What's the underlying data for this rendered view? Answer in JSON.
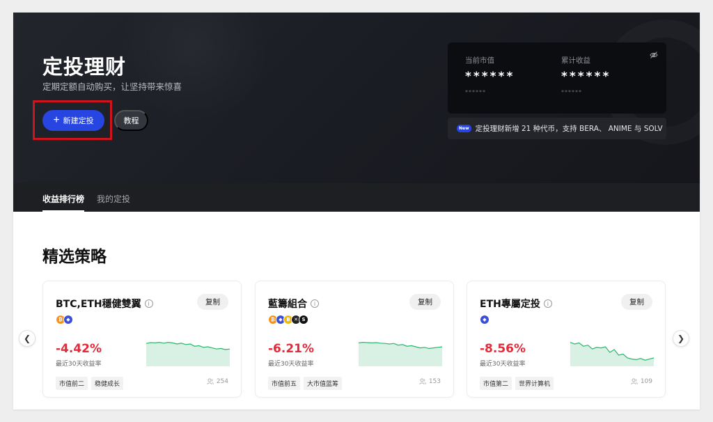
{
  "hero": {
    "title": "定投理财",
    "subtitle": "定期定额自动购买，让坚持带来惊喜",
    "new_button": "新建定投",
    "tutorial_button": "教程"
  },
  "assets": {
    "current_value_label": "当前市值",
    "current_value": "******",
    "current_value_sub": "******",
    "total_profit_label": "累计收益",
    "total_profit": "******",
    "total_profit_sub": "******"
  },
  "notice": {
    "badge": "New",
    "text": "定投理财新增 21 种代币，支持 BERA、 ANIME 与 SOLV"
  },
  "tabs": [
    {
      "label": "收益排行榜",
      "active": true
    },
    {
      "label": "我的定投",
      "active": false
    }
  ],
  "section_title": "精选策略",
  "strategies": [
    {
      "name": "BTC,ETH穩健雙翼",
      "copy": "复制",
      "coins": [
        {
          "icon": "btc-icon",
          "color": "#f7931a"
        },
        {
          "icon": "eth-icon",
          "color": "#3b4fd6"
        }
      ],
      "return": "-4.42%",
      "return_label": "最近30天收益率",
      "tags": [
        "市值前二",
        "稳健成长"
      ],
      "followers": "254",
      "trend": [
        0.82,
        0.85,
        0.84,
        0.86,
        0.83,
        0.86,
        0.84,
        0.8,
        0.83,
        0.78,
        0.8,
        0.72,
        0.74,
        0.68,
        0.7,
        0.66,
        0.62,
        0.64,
        0.6,
        0.62
      ]
    },
    {
      "name": "藍籌組合",
      "copy": "复制",
      "coins": [
        {
          "icon": "btc-icon",
          "color": "#f7931a"
        },
        {
          "icon": "eth-icon",
          "color": "#3b4fd6"
        },
        {
          "icon": "bnb-icon",
          "color": "#f0b90b"
        },
        {
          "icon": "xrp-icon",
          "color": "#222222"
        },
        {
          "icon": "sol-icon",
          "color": "#111111"
        }
      ],
      "return": "-6.21%",
      "return_label": "最近30天收益率",
      "tags": [
        "市值前五",
        "大市值蓝筹"
      ],
      "followers": "153",
      "trend": [
        0.84,
        0.86,
        0.85,
        0.84,
        0.85,
        0.83,
        0.82,
        0.8,
        0.82,
        0.76,
        0.78,
        0.72,
        0.74,
        0.7,
        0.66,
        0.68,
        0.64,
        0.66,
        0.68,
        0.7
      ]
    },
    {
      "name": "ETH專屬定投",
      "copy": "复制",
      "coins": [
        {
          "icon": "eth-icon",
          "color": "#3b4fd6"
        }
      ],
      "return": "-8.56%",
      "return_label": "最近30天收益率",
      "tags": [
        "市值第二",
        "世界计算机"
      ],
      "followers": "109",
      "trend": [
        0.86,
        0.8,
        0.84,
        0.72,
        0.76,
        0.62,
        0.68,
        0.66,
        0.7,
        0.5,
        0.6,
        0.4,
        0.44,
        0.3,
        0.26,
        0.24,
        0.28,
        0.22,
        0.26,
        0.3
      ]
    }
  ],
  "colors": {
    "accent": "#2745e0",
    "negative": "#e02b3a",
    "spark_line": "#2ab46a",
    "highlight": "#d0141e"
  }
}
